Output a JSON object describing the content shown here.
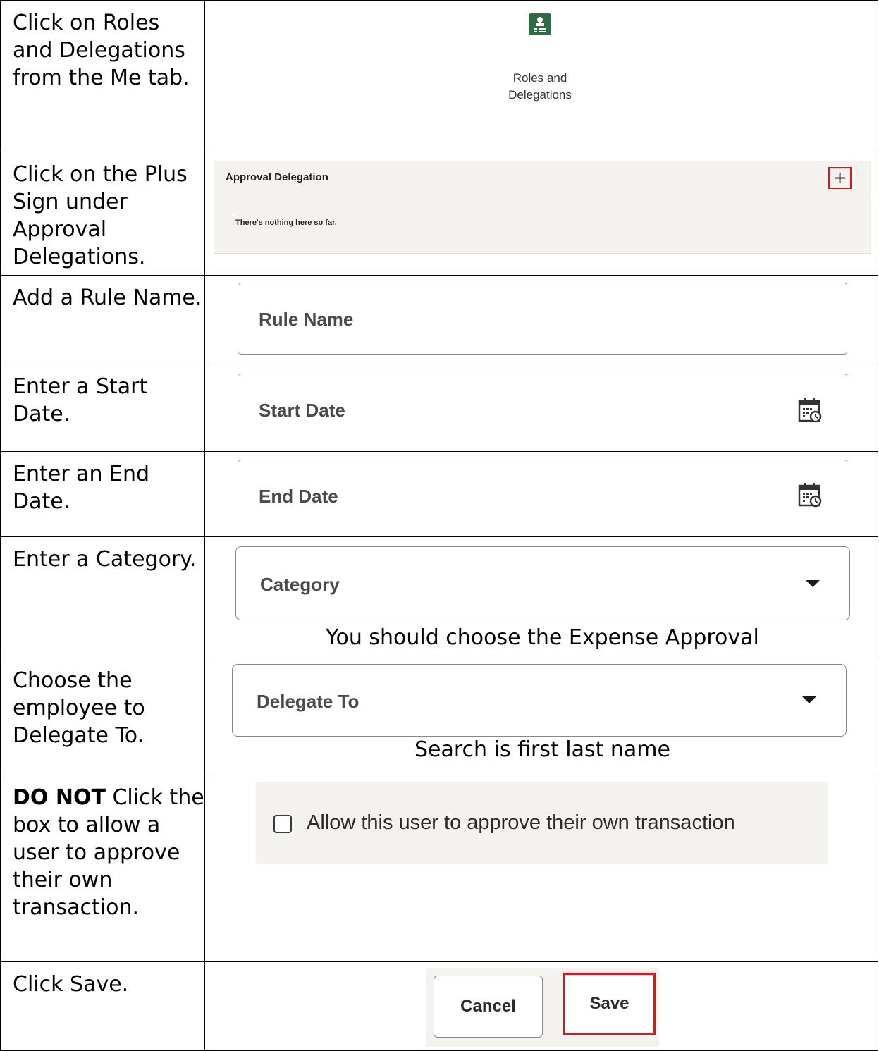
{
  "steps": [
    {
      "text": "Click on Roles and Delegations from the Me tab."
    },
    {
      "text": "Click on the Plus Sign under Approval Delegations."
    },
    {
      "text": "Add a Rule Name."
    },
    {
      "text": "Enter a Start Date."
    },
    {
      "text": "Enter an End Date."
    },
    {
      "text": "Enter a Category."
    },
    {
      "text": "Choose the employee to Delegate To."
    },
    {
      "bold": "DO NOT",
      "text": " Click the box to allow a user to approve their own transaction."
    },
    {
      "text": "Click Save."
    }
  ],
  "roles_tile": {
    "label_line1": "Roles and",
    "label_line2": "Delegations",
    "icon": "roles-and-delegations-icon"
  },
  "approval_panel": {
    "title": "Approval Delegation",
    "empty_message": "There's nothing here so far.",
    "add_icon": "plus-icon"
  },
  "fields": {
    "rule_name": "Rule Name",
    "start_date": "Start Date",
    "end_date": "End Date",
    "category": "Category",
    "delegate_to": "Delegate To",
    "calendar_icon": "calendar-icon",
    "dropdown_icon": "caret-down-icon"
  },
  "captions": {
    "category": "You should choose the Expense Approval",
    "delegate": "Search is first last name"
  },
  "checkbox": {
    "label": "Allow this user to approve their own transaction",
    "checked": false
  },
  "buttons": {
    "cancel": "Cancel",
    "save": "Save"
  },
  "colors": {
    "highlight": "#e0141c",
    "brand_green": "#2f6b45",
    "panel_bg": "#f4f2ee"
  }
}
